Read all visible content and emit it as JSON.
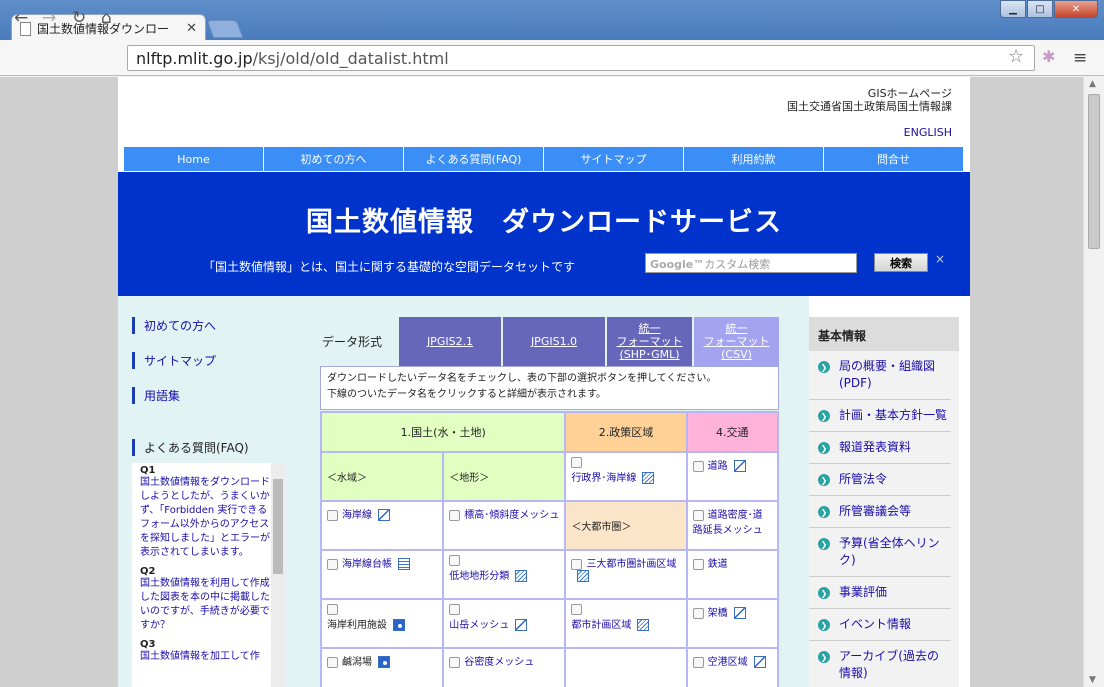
{
  "browser": {
    "tab_title": "国土数値情報ダウンロー",
    "url_host": "nlftp.mlit.go.jp",
    "url_path": "/ksj/old/old_datalist.html"
  },
  "header": {
    "line1": "GISホームページ",
    "line2": "国土交通省国土政策局国土情報課",
    "english": "ENGLISH"
  },
  "gnav": [
    "Home",
    "初めての方へ",
    "よくある質問(FAQ)",
    "サイトマップ",
    "利用約款",
    "問合せ"
  ],
  "banner": {
    "title": "国土数値情報　ダウンロードサービス",
    "subtitle": "「国土数値情報」とは、国土に関する基礎的な空間データセットです",
    "search_placeholder": "カスタム検索",
    "search_brand": "Google™",
    "search_button": "検索",
    "close": "×"
  },
  "left": {
    "links": [
      "初めての方へ",
      "サイトマップ",
      "用語集"
    ],
    "faq_title": "よくある質問(FAQ)",
    "faq": [
      {
        "q": "Q1",
        "a": "国土数値情報をダウンロードしようとしたが、うまくいかず、「Forbidden 実行できるフォーム以外からのアクセスを探知しました」とエラーが表示されてしまいます。"
      },
      {
        "q": "Q2",
        "a": "国土数値情報を利用して作成した図表を本の中に掲載したいのですが、手続きが必要ですか？"
      },
      {
        "q": "Q3",
        "a": "国土数値情報を加工して作"
      }
    ]
  },
  "center": {
    "format_label": "データ形式",
    "tabs": [
      {
        "label": "JPGIS2.1",
        "color": "#6666bb"
      },
      {
        "label": "JPGIS1.0",
        "color": "#6666bb"
      },
      {
        "label": "統一\nフォーマット\n(SHP･GML)",
        "color": "#6666bb"
      },
      {
        "label": "統一\nフォーマット\n(CSV)",
        "color": "#a3a3f0"
      }
    ],
    "instruction1": "ダウンロードしたいデータ名をチェックし、表の下部の選択ボタンを押してください。",
    "instruction2": "下線のついたデータ名をクリックすると詳細が表示されます。",
    "cat1": "1.国土(水・土地)",
    "cat2": "2.政策区域",
    "cat4": "4.交通",
    "c1_water": "＜水域＞",
    "c1_land": "＜地形＞",
    "gyosei": "行政界･海岸線",
    "doro": "道路",
    "kaigansen": "海岸線",
    "hyoko": "標高･傾斜度メッシュ",
    "daitoshi": "＜大都市圏＞",
    "dorokmitsu": "道路密度･道路延長メッシュ",
    "kaigan_daicho": "海岸線台帳",
    "teichi": "低地地形分類",
    "sandai": "三大都市圏計画区域",
    "tetsudo": "鉄道",
    "kaigan_riyo": "海岸利用施設",
    "sangaku": "山岳メッシュ",
    "toshikeikaku": "都市計画区域",
    "kakyo": "架橋",
    "kanyojo": "鹹潟場",
    "kokumitsudo": "谷密度メッシュ",
    "kuko": "空港区域"
  },
  "right": {
    "title": "基本情報",
    "items": [
      "局の概要・組織図(PDF)",
      "計画・基本方針一覧",
      "報道発表資料",
      "所管法令",
      "所管審議会等",
      "予算(省全体ヘリンク)",
      "事業評価",
      "イベント情報",
      "アーカイブ(過去の情報)"
    ]
  },
  "colors": {
    "nav_blue": "#3a8ef6",
    "banner_blue": "#0033cc",
    "cat1": "#e0ffc0",
    "cat2": "#ffd197",
    "cat4": "#ffb3d9",
    "side_bg": "#e1f3f3"
  }
}
